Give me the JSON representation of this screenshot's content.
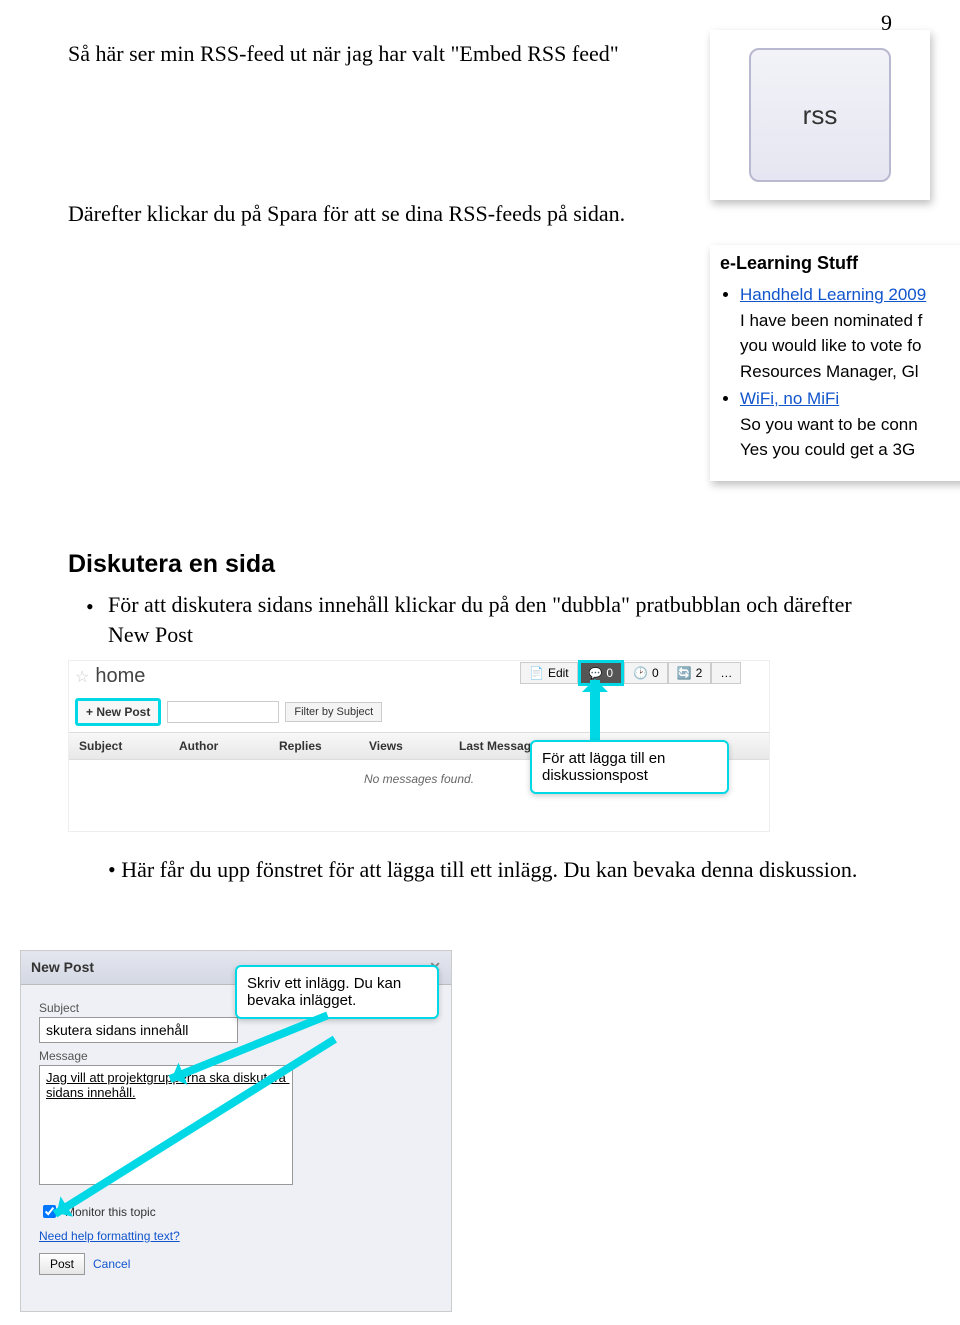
{
  "page_number": "9",
  "para1": "Så här ser min RSS-feed ut när jag har valt \"Embed RSS feed\"",
  "para2": "Därefter klickar du på Spara för att se dina RSS-feeds på sidan.",
  "rss_tile_label": "rss",
  "rss_preview": {
    "title": "e-Learning Stuff",
    "items": [
      {
        "link": "Handheld Learning 2009",
        "lines": [
          "I have been nominated f",
          "you would like to vote fo",
          "Resources Manager, Gl"
        ]
      },
      {
        "link": "WiFi, no MiFi",
        "lines": [
          "So you want to be conn",
          "Yes you could get a 3G"
        ]
      }
    ]
  },
  "section_heading": "Diskutera en sida",
  "bullet1": "För att diskutera sidans innehåll klickar du på den \"dubbla\" pratbubblan och därefter New Post",
  "bullet2": "Här får du upp fönstret för att lägga till ett inlägg. Du kan bevaka denna diskussion.",
  "disc": {
    "home_label": "home",
    "new_post_btn": "+ New Post",
    "filter_btn": "Filter by Subject",
    "headers": {
      "subject": "Subject",
      "author": "Author",
      "replies": "Replies",
      "views": "Views",
      "last": "Last Message ▴"
    },
    "empty": "No messages found."
  },
  "topbar": {
    "edit": "Edit",
    "discuss_count": "0",
    "history_count": "0",
    "other": "2",
    "more": "…"
  },
  "tooltip1": "För att lägga till en diskussionspost",
  "tooltip2": "Skriv ett inlägg. Du kan bevaka inlägget.",
  "dialog": {
    "title": "New Post",
    "subject_label": "Subject",
    "subject_value": "skutera sidans innehåll",
    "message_label": "Message",
    "message_value": "Jag vill att projektgrupperna ska diskutera sidans innehåll.",
    "monitor_label": "Monitor this topic",
    "help_link": "Need help formatting text?",
    "post_btn": "Post",
    "cancel_link": "Cancel"
  }
}
